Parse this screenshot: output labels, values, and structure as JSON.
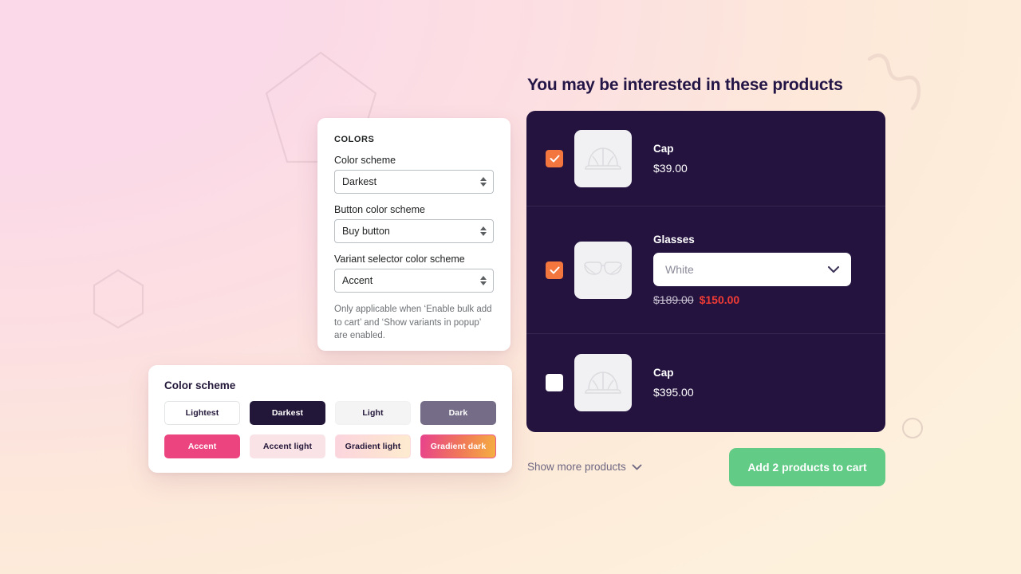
{
  "colors_panel": {
    "heading": "COLORS",
    "fields": [
      {
        "label": "Color scheme",
        "value": "Darkest"
      },
      {
        "label": "Button color scheme",
        "value": "Buy button"
      },
      {
        "label": "Variant selector color scheme",
        "value": "Accent"
      }
    ],
    "help_text": "Only applicable when ‘Enable bulk add to cart’ and ‘Show variants in popup’ are enabled."
  },
  "scheme_panel": {
    "title": "Color scheme",
    "swatches": [
      {
        "label": "Lightest",
        "bg": "#ffffff",
        "text": "#231739",
        "border": "#e1e3e5"
      },
      {
        "label": "Darkest",
        "bg": "#231739",
        "text": "#ffffff",
        "border": "#231739"
      },
      {
        "label": "Light",
        "bg": "#f4f4f4",
        "text": "#231739",
        "border": "#f1f1f1"
      },
      {
        "label": "Dark",
        "bg": "#756d87",
        "text": "#ffffff",
        "border": "#756d87"
      },
      {
        "label": "Accent",
        "bg": "#ec447f",
        "text": "#ffffff",
        "border": "#ec447f"
      },
      {
        "label": "Accent light",
        "bg": "#f9e3e7",
        "text": "#231739",
        "border": "#f9e3e7"
      },
      {
        "label": "Gradient light",
        "bg": "#fbd9de",
        "text": "#231739",
        "border": "#fbd9de"
      },
      {
        "label": "Gradient dark",
        "bg": "#e8558f",
        "text": "#ffffff",
        "border": "#e8558f"
      }
    ]
  },
  "recommendations": {
    "title": "You may be interested in these products",
    "products": [
      {
        "name": "Cap",
        "price": "$39.00",
        "checked": true,
        "thumb_icon": "cap-icon",
        "has_variant": false
      },
      {
        "name": "Glasses",
        "checked": true,
        "thumb_icon": "glasses-icon",
        "has_variant": true,
        "variant_value": "White",
        "price_original": "$189.00",
        "price_sale": "$150.00"
      },
      {
        "name": "Cap",
        "price": "$395.00",
        "checked": false,
        "thumb_icon": "cap-icon",
        "has_variant": false
      }
    ],
    "show_more_label": "Show more products",
    "add_to_cart_label": "Add 2 products to cart"
  },
  "theme": {
    "card_dark": "#24133f",
    "checkbox_accent": "#f3763f",
    "cta_green": "#62cb86",
    "sale_red": "#f23b34",
    "bg_start": "#fbd9e8",
    "bg_end": "#fdf1dc"
  }
}
